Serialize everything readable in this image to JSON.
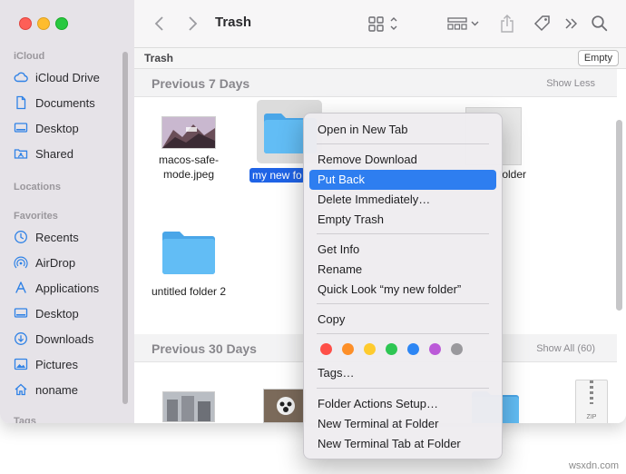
{
  "window": {
    "title": "Trash"
  },
  "sidebar": {
    "sections": {
      "icloud": "iCloud",
      "locations": "Locations",
      "favorites": "Favorites",
      "tags": "Tags"
    },
    "icloud_items": [
      {
        "label": "iCloud Drive",
        "icon": "cloud-icon"
      },
      {
        "label": "Documents",
        "icon": "document-icon"
      },
      {
        "label": "Desktop",
        "icon": "desktop-icon"
      },
      {
        "label": "Shared",
        "icon": "shared-folder-icon"
      }
    ],
    "favorite_items": [
      {
        "label": "Recents",
        "icon": "clock-icon"
      },
      {
        "label": "AirDrop",
        "icon": "airdrop-icon"
      },
      {
        "label": "Applications",
        "icon": "applications-icon"
      },
      {
        "label": "Desktop",
        "icon": "desktop-icon"
      },
      {
        "label": "Downloads",
        "icon": "download-icon"
      },
      {
        "label": "Pictures",
        "icon": "pictures-icon"
      },
      {
        "label": "noname",
        "icon": "home-icon"
      }
    ]
  },
  "pathbar": {
    "label": "Trash",
    "empty_button": "Empty"
  },
  "groups": [
    {
      "title": "Previous 7 Days",
      "action": "Show Less"
    },
    {
      "title": "Previous 30 Days",
      "action": "Show All (60)"
    }
  ],
  "files": [
    {
      "name_line1": "macos-safe-",
      "name_line2": "mode.jpeg"
    },
    {
      "name": "my new folder",
      "visible_name": "my new fo"
    },
    {
      "name": "untitled folder 2"
    },
    {
      "partial_label": "folder"
    }
  ],
  "context_menu": {
    "items": [
      {
        "label": "Open in New Tab"
      },
      {
        "label": "Remove Download"
      },
      {
        "label": "Put Back"
      },
      {
        "label": "Delete Immediately…"
      },
      {
        "label": "Empty Trash"
      },
      {
        "label": "Get Info"
      },
      {
        "label": "Rename"
      },
      {
        "label": "Quick Look “my new folder”"
      },
      {
        "label": "Copy"
      },
      {
        "label": "Tags…"
      },
      {
        "label": "Folder Actions Setup…"
      },
      {
        "label": "New Terminal at Folder"
      },
      {
        "label": "New Terminal Tab at Folder"
      }
    ],
    "selected": "Put Back",
    "tag_colors": [
      "#fe4f48",
      "#fd8f28",
      "#fecb2e",
      "#2ec653",
      "#2d86f4",
      "#bb5ad8",
      "#9a999d"
    ]
  },
  "theme": {
    "accent": "#2e7ef0",
    "folder": "#5ab8f2"
  },
  "watermark": "wsxdn.com"
}
